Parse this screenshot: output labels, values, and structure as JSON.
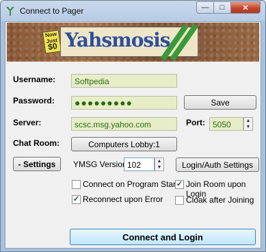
{
  "window": {
    "title": "Connect to Pager",
    "minimize_glyph": "—",
    "maximize_glyph": "□",
    "close_glyph": "✕"
  },
  "banner": {
    "badge_line1": "Now",
    "badge_line2": "Just",
    "badge_price": "$0",
    "logo_text": "Yahsmosis"
  },
  "form": {
    "username_label": "Username:",
    "username_value": "Softpedia",
    "password_label": "Password:",
    "password_value": "●●●●●●●●●",
    "save_label": "Save",
    "server_label": "Server:",
    "server_value": "scsc.msg.yahoo.com",
    "port_label": "Port:",
    "port_value": "5050",
    "chatroom_label": "Chat Room:",
    "chatroom_button": "Computers Lobby:1",
    "settings_button": "- Settings",
    "ymsg_label": "YMSG Version",
    "ymsg_value": "102",
    "login_auth_button": "Login/Auth Settings"
  },
  "options": {
    "connect_on_start": {
      "label": "Connect on Program Start",
      "checked": false
    },
    "join_room_on_login": {
      "label": "Join Room upon Login",
      "checked": true
    },
    "reconnect_on_error": {
      "label": "Reconnect upon Error",
      "checked": true
    },
    "cloak_after_joining": {
      "label": "Cloak after Joining",
      "checked": false
    }
  },
  "actions": {
    "connect_button": "Connect and Login"
  },
  "spinner": {
    "up": "▲",
    "down": "▼"
  },
  "check_glyph": "✓",
  "colors": {
    "field_bg": "#e6edc7",
    "field_text": "#2a6b14"
  }
}
